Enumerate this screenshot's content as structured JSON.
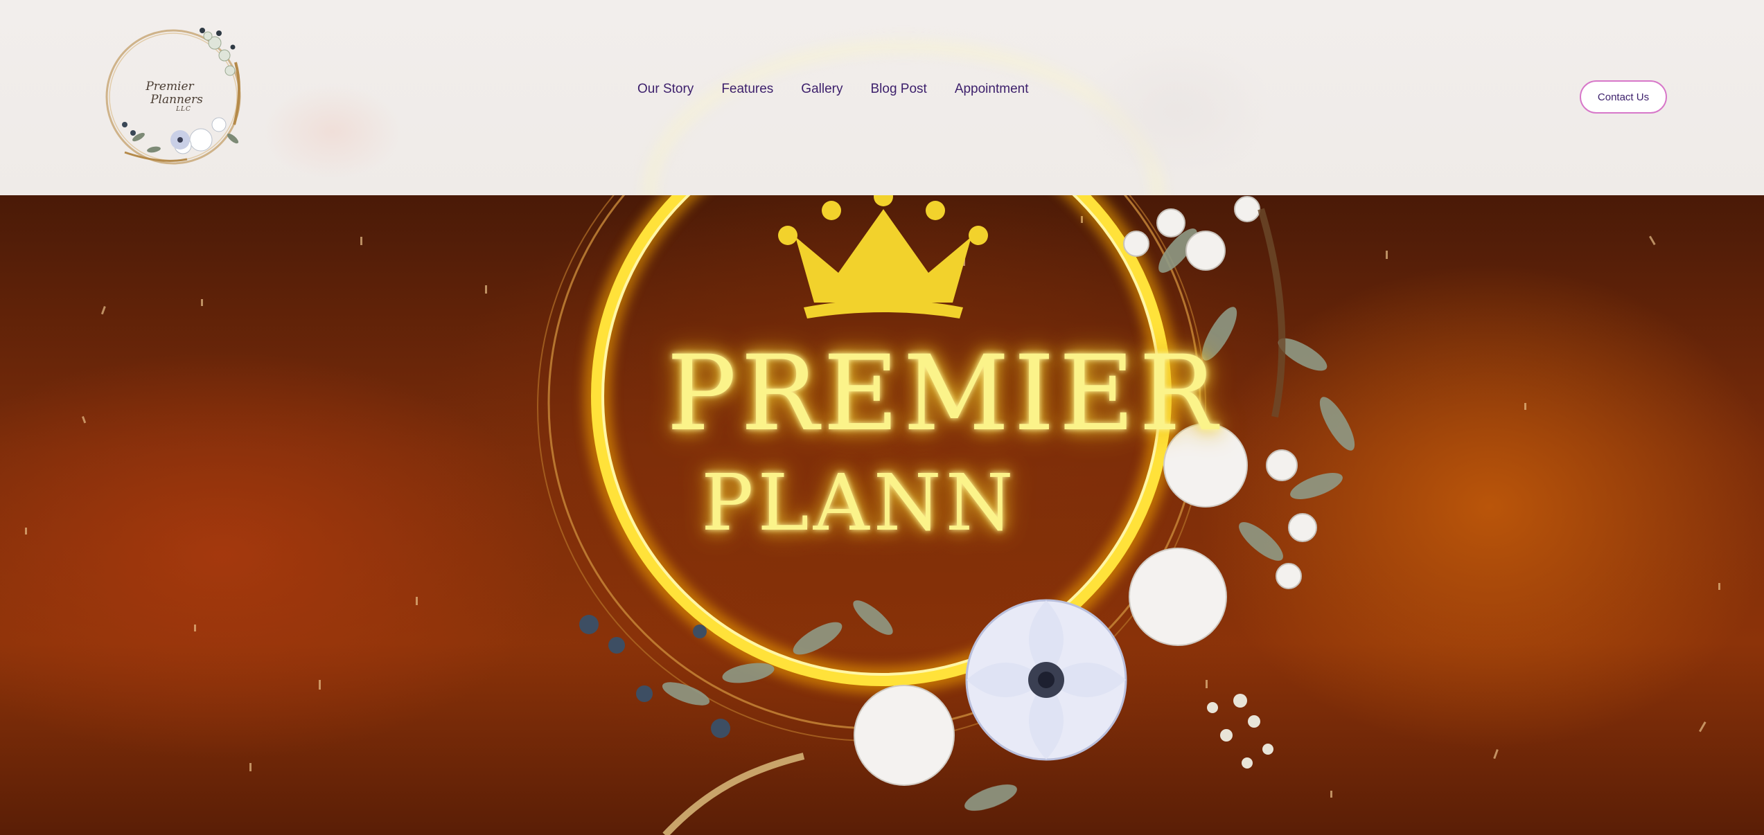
{
  "logo": {
    "line1": "Premier",
    "line2": "Planners",
    "line3": "LLC"
  },
  "nav": {
    "items": [
      {
        "label": "Our Story"
      },
      {
        "label": "Features"
      },
      {
        "label": "Gallery"
      },
      {
        "label": "Blog Post"
      },
      {
        "label": "Appointment"
      }
    ]
  },
  "contact_button": {
    "label": "Contact Us"
  },
  "hero": {
    "title_line1": "PREMIER",
    "title_line2": "PLANN"
  },
  "colors": {
    "nav_text": "#3c1f6b",
    "button_border": "#d777c9",
    "header_bg": "#f1eeec",
    "hero_glow": "#fbf38a",
    "crown": "#f2d22c"
  },
  "icons": {
    "logo": "floral-wreath-logo",
    "crown": "crown-icon"
  }
}
